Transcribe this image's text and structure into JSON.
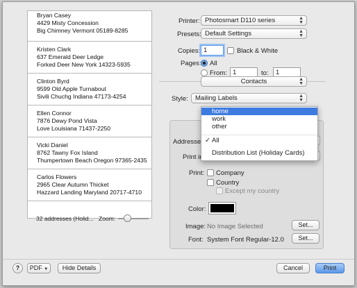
{
  "preview": {
    "labels": [
      {
        "name": "Bryan Casey",
        "street": "4429 Misty Concession",
        "city": "Big Chimney Vermont 05189-8285"
      },
      {
        "name": "Kristen Clark",
        "street": "637 Emerald Deer Ledge",
        "city": "Forked Deer New York 14323-5935"
      },
      {
        "name": "Clinton Byrd",
        "street": "9599 Old Apple Turnabout",
        "city": "Sivili Chuchg Indiana 47173-4254"
      },
      {
        "name": "Ellen Connor",
        "street": "7876 Dewy Pond Vista",
        "city": "Love Louisiana 71437-2250"
      },
      {
        "name": "Vicki Daniel",
        "street": "8762 Tawny Fox Island",
        "city": "Thumpertown Beach Oregon 97365-2435"
      },
      {
        "name": "Carlos Flowers",
        "street": "2965 Clear Autumn Thicket",
        "city": "Hazzard Landing Maryland 20717-4710"
      }
    ],
    "count_label": "32 addresses (Holid...",
    "zoom_label": "Zoom:"
  },
  "printer": {
    "label": "Printer:",
    "value": "Photosmart D110 series"
  },
  "presets": {
    "label": "Presets:",
    "value": "Default Settings"
  },
  "copies": {
    "label": "Copies:",
    "value": "1",
    "bw_label": "Black & White"
  },
  "pages": {
    "label": "Pages:",
    "all_label": "All",
    "from_label": "From:",
    "from_value": "1",
    "to_label": "to:",
    "to_value": "1"
  },
  "section": {
    "value": "Contacts"
  },
  "style": {
    "label": "Style:",
    "value": "Mailing Labels"
  },
  "panel": {
    "addresses_label": "Addresses",
    "print_in_label": "Print in",
    "print_label": "Print:",
    "company_label": "Company",
    "country_label": "Country",
    "except_label": "Except my country",
    "color_label": "Color:",
    "color_value": "#000000",
    "image_label": "Image:",
    "image_value": "No Image Selected",
    "image_set": "Set...",
    "font_label": "Font:",
    "font_value": "System Font Regular-12.0",
    "font_set": "Set..."
  },
  "menu": {
    "items": [
      "home",
      "work",
      "other"
    ],
    "checked_item": "All",
    "distribution_item": "Distribution List (Holiday Cards)"
  },
  "footer": {
    "help": "?",
    "pdf": "PDF",
    "hide_details": "Hide Details",
    "cancel": "Cancel",
    "print": "Print"
  },
  "colors": {
    "accent": "#3e7be0",
    "print_button": "#6aa4f0"
  }
}
